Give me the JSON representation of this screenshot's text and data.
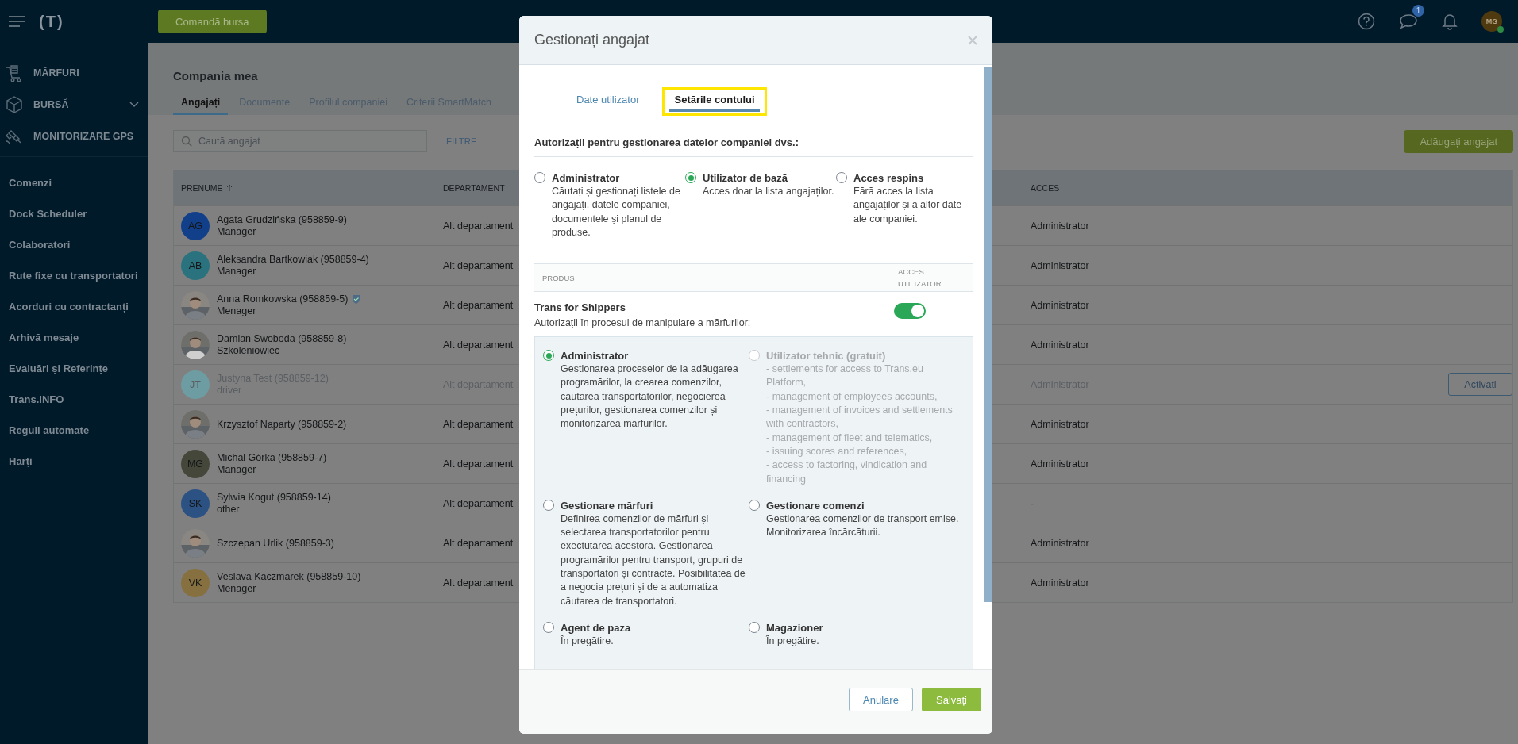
{
  "topbar": {
    "logo": "(T)",
    "order_button": "Comandă bursa",
    "messages_badge": "1",
    "user": {
      "initials": "MG",
      "online": true
    }
  },
  "sidebar": {
    "modules": [
      {
        "label": "MĂRFURI",
        "kind": "cargo",
        "has_submenu": false
      },
      {
        "label": "BURSĂ",
        "kind": "exchange",
        "has_submenu": true
      },
      {
        "label": "MONITORIZARE GPS",
        "kind": "gps",
        "has_submenu": false
      }
    ],
    "links": [
      "Comenzi",
      "Dock Scheduler",
      "Colaboratori",
      "Rute fixe cu transportatori",
      "Acorduri cu contractanți",
      "Arhivă mesaje",
      "Evaluări și Referințe",
      "Trans.INFO",
      "Reguli automate",
      "Hărți"
    ]
  },
  "page": {
    "title": "Compania mea",
    "tabs": [
      {
        "label": "Angajați",
        "selected": true
      },
      {
        "label": "Documente",
        "selected": false
      },
      {
        "label": "Profilul companiei",
        "selected": false
      },
      {
        "label": "Criterii SmartMatch",
        "selected": false
      }
    ],
    "search": {
      "placeholder": "Caută angajat"
    },
    "filters": "FILTRE",
    "add_button": "Adăugați angajat"
  },
  "table": {
    "columns": [
      {
        "label": "PRENUME",
        "sorted": true
      },
      {
        "label": "DEPARTAMENT",
        "sorted": false
      },
      {
        "label": "ACCES",
        "sorted": false
      }
    ],
    "rows": [
      {
        "avatar": {
          "kind": "initials",
          "text": "AG",
          "color": "#123f8a"
        },
        "name": "Agata Grudzińska (958859-9)",
        "role": "Manager",
        "verified": false,
        "department": "Alt departament",
        "access": "Administrator",
        "disabled": false
      },
      {
        "avatar": {
          "kind": "initials",
          "text": "AB",
          "color": "#2a737e"
        },
        "name": "Aleksandra Bartkowiak (958859-4)",
        "role": "Manager",
        "verified": false,
        "department": "Alt departament",
        "access": "Administrator",
        "disabled": false
      },
      {
        "name": "Anna Romkowska (958859-5)",
        "role": "Menager",
        "verified": true,
        "department": "Alt departament",
        "access": "Administrator",
        "disabled": false
      },
      {
        "name": "Damian Swoboda (958859-8)",
        "role": "Szkoleniowiec",
        "verified": false,
        "department": "Alt departament",
        "access": "Administrator",
        "disabled": false
      },
      {
        "avatar": {
          "kind": "initials",
          "text": "JT",
          "color": "#6e9ca3"
        },
        "name": "Justyna Test (958859-12)",
        "role": "driver",
        "verified": false,
        "department": "Alt departament",
        "access": "Administrator",
        "disabled": true,
        "action": "Activati"
      },
      {
        "name": "Krzysztof Naparty (958859-2)",
        "verified": false,
        "department": "Alt departament",
        "access": "Administrator",
        "disabled": false
      },
      {
        "avatar": {
          "kind": "initials",
          "text": "MG",
          "color": "#44473a"
        },
        "name": "Michał Górka (958859-7)",
        "role": "Manager",
        "verified": false,
        "department": "Alt departament",
        "access": "Administrator",
        "disabled": false
      },
      {
        "avatar": {
          "kind": "initials",
          "text": "SK",
          "color": "#2c5183"
        },
        "name": "Sylwia Kogut (958859-14)",
        "role": "other",
        "verified": false,
        "department": "Alt departament",
        "access": "-",
        "disabled": false
      },
      {
        "name": "Szczepan Urlik (958859-3)",
        "verified": false,
        "department": "Alt departament",
        "access": "Administrator",
        "disabled": false
      },
      {
        "avatar": {
          "kind": "initials",
          "text": "VK",
          "color": "#86703f"
        },
        "name": "Veslava Kaczmarek (958859-10)",
        "role": "Menager",
        "verified": false,
        "department": "Alt departament",
        "access": "Administrator",
        "disabled": false
      }
    ]
  },
  "modal": {
    "title": "Gestionați angajat",
    "tabs": [
      {
        "label": "Date utilizator",
        "selected": false,
        "highlighted": false
      },
      {
        "label": "Setările contului",
        "selected": true,
        "highlighted": true
      }
    ],
    "permissions": {
      "heading": "Autorizații pentru gestionarea datelor companiei dvs.:",
      "options": [
        {
          "title": "Administrator",
          "description": "Căutați și gestionați listele de angajați, datele companiei, documentele și planul de produse.",
          "selected": false
        },
        {
          "title": "Utilizator de bază",
          "description": "Acces doar la lista angajaților.",
          "selected": true
        },
        {
          "title": "Acces respins",
          "description": "Fără acces la lista angajaților și a altor date ale companiei.",
          "selected": false
        }
      ]
    },
    "products": {
      "columns": [
        "PRODUS",
        "ACCES UTILIZATOR"
      ],
      "items": [
        {
          "name": "Trans for Shippers",
          "subtitle": "Autorizații în procesul de manipulare a mărfurilor:",
          "access": true,
          "roles": [
            {
              "title": "Administrator",
              "description": "Gestionarea proceselor de la adăugarea programărilor, la crearea comenzilor, căutarea transportatorilor, negocierea prețurilor, gestionarea comenzilor și monitorizarea mărfurilor.",
              "selected": true,
              "disabled": false
            },
            {
              "title": "Utilizator tehnic (gratuit)",
              "description": "- settlements for access to Trans.eu Platform,\n- management of employees accounts,\n- management of invoices and settlements with contractors,\n- management of fleet and telematics,\n- issuing scores and references,\n- access to factoring, vindication and financing",
              "selected": false,
              "disabled": true
            },
            {
              "title": "Gestionare mărfuri",
              "description": "Definirea comenzilor de mărfuri și selectarea transportatorilor pentru exectutarea acestora. Gestionarea programărilor pentru transport, grupuri de transportatori și contracte. Posibilitatea de a negocia prețuri și de a automatiza căutarea de transportatori.",
              "selected": false,
              "disabled": false
            },
            {
              "title": "Gestionare comenzi",
              "description": "Gestionarea comenzilor de transport emise. Monitorizarea încărcăturii.",
              "selected": false,
              "disabled": false
            },
            {
              "title": "Agent de paza",
              "description": "În pregătire.",
              "selected": false,
              "disabled": false
            },
            {
              "title": "Magazioner",
              "description": "În pregătire.",
              "selected": false,
              "disabled": false
            }
          ]
        }
      ]
    },
    "buttons": {
      "cancel": "Anulare",
      "save": "Salvați"
    }
  }
}
